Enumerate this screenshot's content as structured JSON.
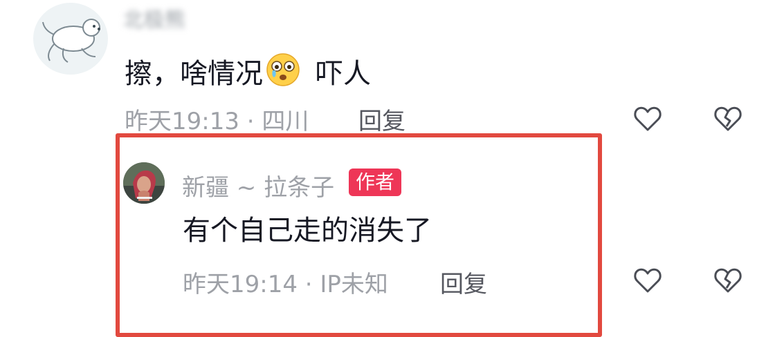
{
  "top_comment": {
    "username": "北极熊",
    "text_before_emoji": "擦，啥情况",
    "emoji": "crying-face-emoji",
    "text_after_emoji": "吓人",
    "time_location": "昨天19:13 · 四川",
    "reply_label": "回复",
    "like_icon": "heart-outline-icon",
    "dislike_icon": "broken-heart-icon"
  },
  "reply_comment": {
    "username": "新疆 ~ 拉条子",
    "badge": "作者",
    "text": "有个自己走的消失了",
    "time_location": "昨天19:14 · IP未知",
    "reply_label": "回复",
    "like_icon": "heart-outline-icon",
    "dislike_icon": "broken-heart-icon"
  },
  "colors": {
    "highlight_border": "#e2493f",
    "badge_bg": "#ee3657",
    "meta_text": "#9ea1a7",
    "body_text": "#161823"
  }
}
